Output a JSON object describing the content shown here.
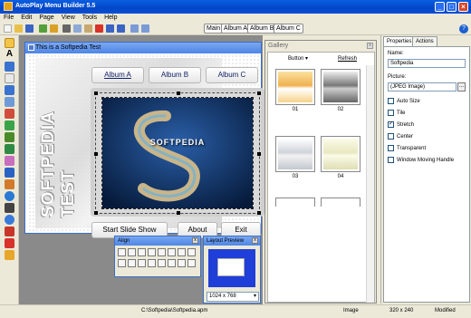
{
  "app": {
    "title": "AutoPlay Menu Builder 5.5"
  },
  "menu": [
    "File",
    "Edit",
    "Page",
    "View",
    "Tools",
    "Help"
  ],
  "doc_tabs": [
    "Main",
    "Album A",
    "Album B",
    "Album C"
  ],
  "window": {
    "title": "This is a Softpedia Test"
  },
  "canvas": {
    "vertical_text": "SOFTPEDIA TEST",
    "album_buttons": [
      "Album A",
      "Album B",
      "Album C"
    ],
    "start_button": "Start Slide Show",
    "about_button": "About",
    "exit_button": "Exit",
    "photo_text": "SOFTPEDIA"
  },
  "align": {
    "title": "Align"
  },
  "layout_preview": {
    "title": "Layout Preview",
    "resolution": "1024 x 768"
  },
  "gallery": {
    "title": "Gallery",
    "col_button": "Button",
    "col_refresh": "Refresh",
    "items": [
      "01",
      "02",
      "03",
      "04"
    ]
  },
  "properties": {
    "tabs": [
      "Properties",
      "Actions"
    ],
    "name_label": "Name:",
    "name_value": "Softpedia",
    "picture_label": "Picture:",
    "picture_value": "(JPEG Image)",
    "checks": [
      {
        "label": "Auto Size",
        "checked": false
      },
      {
        "label": "Tile",
        "checked": false
      },
      {
        "label": "Stretch",
        "checked": true
      },
      {
        "label": "Center",
        "checked": false
      },
      {
        "label": "Transparent",
        "checked": false
      },
      {
        "label": "Window Moving Handle",
        "checked": false
      }
    ]
  },
  "status": {
    "path": "C:\\Softpedia\\Softpedia.apm",
    "type": "Image",
    "size": "320 x 240",
    "state": "Modified"
  }
}
